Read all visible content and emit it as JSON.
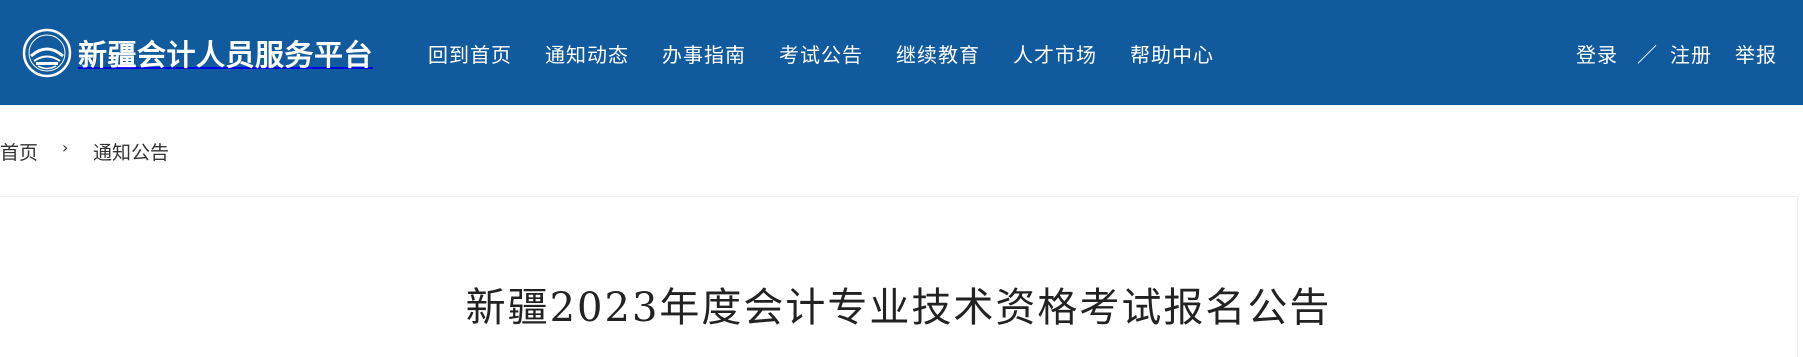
{
  "header": {
    "site_name": "新疆会计人员服务平台",
    "logo_icon": "accounting-association-emblem-icon",
    "brand_color": "#115a9e",
    "nav": [
      {
        "label": "回到首页"
      },
      {
        "label": "通知动态"
      },
      {
        "label": "办事指南"
      },
      {
        "label": "考试公告"
      },
      {
        "label": "继续教育"
      },
      {
        "label": "人才市场"
      },
      {
        "label": "帮助中心"
      }
    ],
    "auth": {
      "login": "登录",
      "separator": "／",
      "register": "注册",
      "report": "举报"
    }
  },
  "breadcrumb": {
    "home": "首页",
    "separator": "›",
    "current": "通知公告"
  },
  "article": {
    "title": "新疆2023年度会计专业技术资格考试报名公告"
  }
}
